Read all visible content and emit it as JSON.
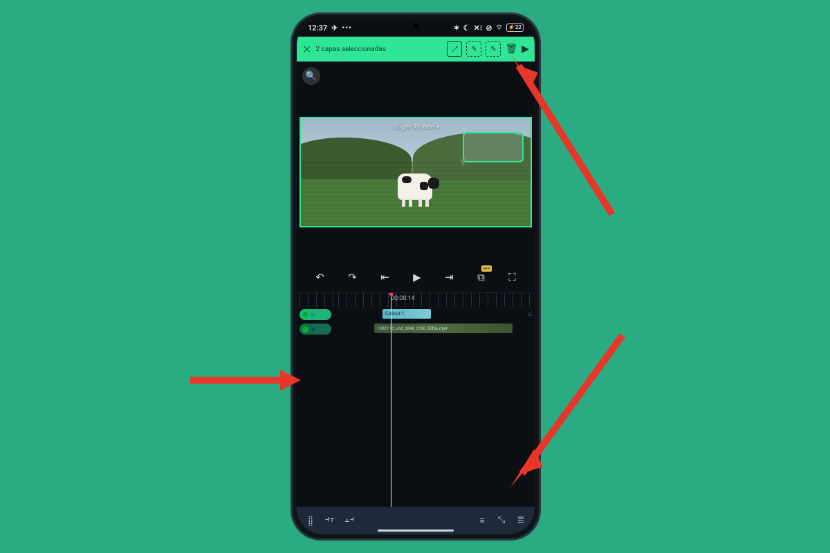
{
  "status": {
    "time": "12:37",
    "battery": "22"
  },
  "selection": {
    "label": "2 capas seleccionadas"
  },
  "watermark": "Alight Motion",
  "timecode": "00:00:14",
  "tracks": {
    "callout_label": "Callout 1",
    "video_label": "15921 92_uhd_3840_2160_50fps.mp4"
  }
}
